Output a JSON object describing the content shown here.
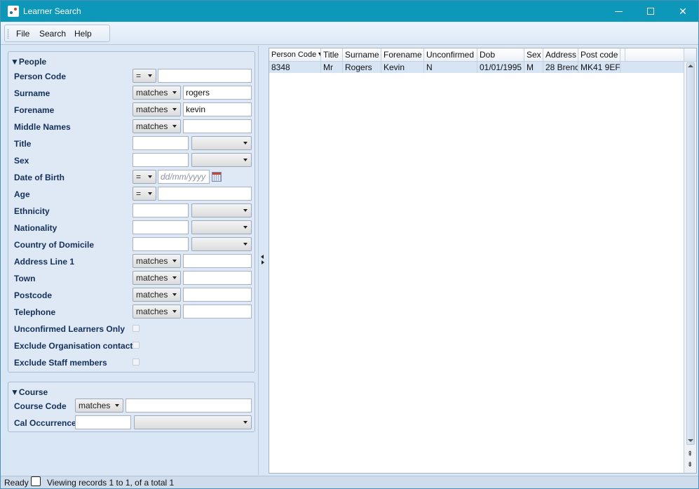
{
  "window": {
    "title": "Learner Search"
  },
  "menu": [
    "File",
    "Search",
    "Help"
  ],
  "people": {
    "title": "▼People",
    "rows": [
      {
        "label": "Person Code",
        "op": "=",
        "value": ""
      },
      {
        "label": "Surname",
        "op": "matches",
        "value": "rogers"
      },
      {
        "label": "Forename",
        "op": "matches",
        "value": "kevin"
      },
      {
        "label": "Middle Names",
        "op": "matches",
        "value": ""
      },
      {
        "label": "Title"
      },
      {
        "label": "Sex"
      },
      {
        "label": "Date of Birth",
        "op": "=",
        "placeholder": "dd/mm/yyyy"
      },
      {
        "label": "Age",
        "op": "=",
        "value": ""
      },
      {
        "label": "Ethnicity"
      },
      {
        "label": "Nationality"
      },
      {
        "label": "Country of Domicile"
      },
      {
        "label": "Address Line 1",
        "op": "matches",
        "value": ""
      },
      {
        "label": "Town",
        "op": "matches",
        "value": ""
      },
      {
        "label": "Postcode",
        "op": "matches",
        "value": ""
      },
      {
        "label": "Telephone",
        "op": "matches",
        "value": ""
      },
      {
        "label": "Unconfirmed Learners Only",
        "checked": false
      },
      {
        "label": "Exclude Organisation contacts",
        "checked": false
      },
      {
        "label": "Exclude Staff members",
        "checked": false
      }
    ]
  },
  "course": {
    "title": "▼Course",
    "rows": [
      {
        "label": "Course Code",
        "op": "matches",
        "value": ""
      },
      {
        "label": "Cal Occurrence"
      }
    ]
  },
  "grid": {
    "columns": [
      "Person Code",
      "Title",
      "Surname",
      "Forename",
      "Unconfirmed",
      "Dob",
      "Sex",
      "Address",
      "Post code"
    ],
    "rows": [
      [
        "8348",
        "Mr",
        "Rogers",
        "Kevin",
        "N",
        "01/01/1995",
        "M",
        "28 Brenc",
        "MK41 9EF"
      ]
    ]
  },
  "status": {
    "ready": "Ready",
    "info": "Viewing records 1 to 1, of a total 1"
  },
  "icons": {
    "app": "app-icon",
    "calendar": "calendar-icon",
    "sort": "sort-desc-icon"
  }
}
